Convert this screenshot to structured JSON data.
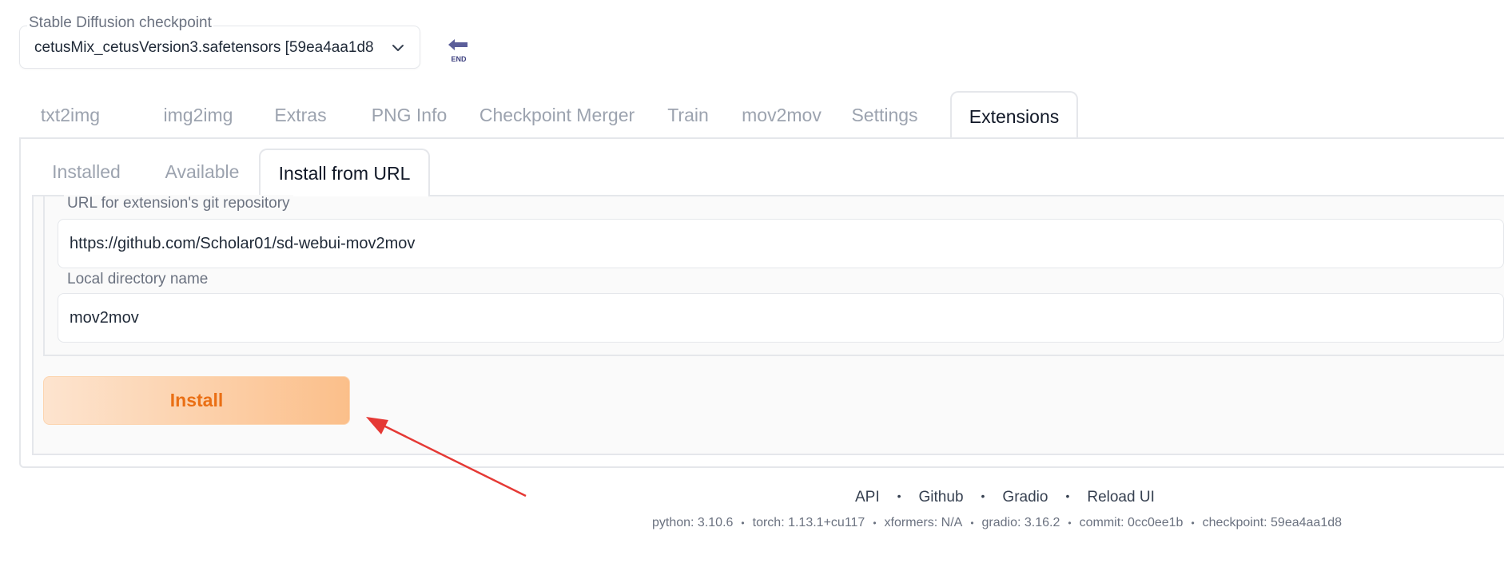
{
  "checkpoint": {
    "label": "Stable Diffusion checkpoint",
    "value": "cetusMix_cetusVersion3.safetensors [59ea4aa1d8]",
    "refresh_icon_text": "END"
  },
  "top_tabs": [
    "txt2img",
    "img2img",
    "Extras",
    "PNG Info",
    "Checkpoint Merger",
    "Train",
    "mov2mov",
    "Settings",
    "Extensions"
  ],
  "active_top_tab": "Extensions",
  "sub_tabs": [
    "Installed",
    "Available",
    "Install from URL"
  ],
  "active_sub_tab": "Install from URL",
  "form": {
    "url_label": "URL for extension's git repository",
    "url_value": "https://github.com/Scholar01/sd-webui-mov2mov",
    "dir_label": "Local directory name",
    "dir_value": "mov2mov",
    "install_label": "Install"
  },
  "footer": {
    "links": [
      "API",
      "Github",
      "Gradio",
      "Reload UI"
    ],
    "versions": [
      "python: 3.10.6",
      "torch: 1.13.1+cu117",
      "xformers: N/A",
      "gradio: 3.16.2",
      "commit: 0cc0ee1b",
      "checkpoint: 59ea4aa1d8"
    ]
  },
  "colors": {
    "accent_orange": "#ea6f14",
    "annotation_arrow": "#e53935"
  }
}
